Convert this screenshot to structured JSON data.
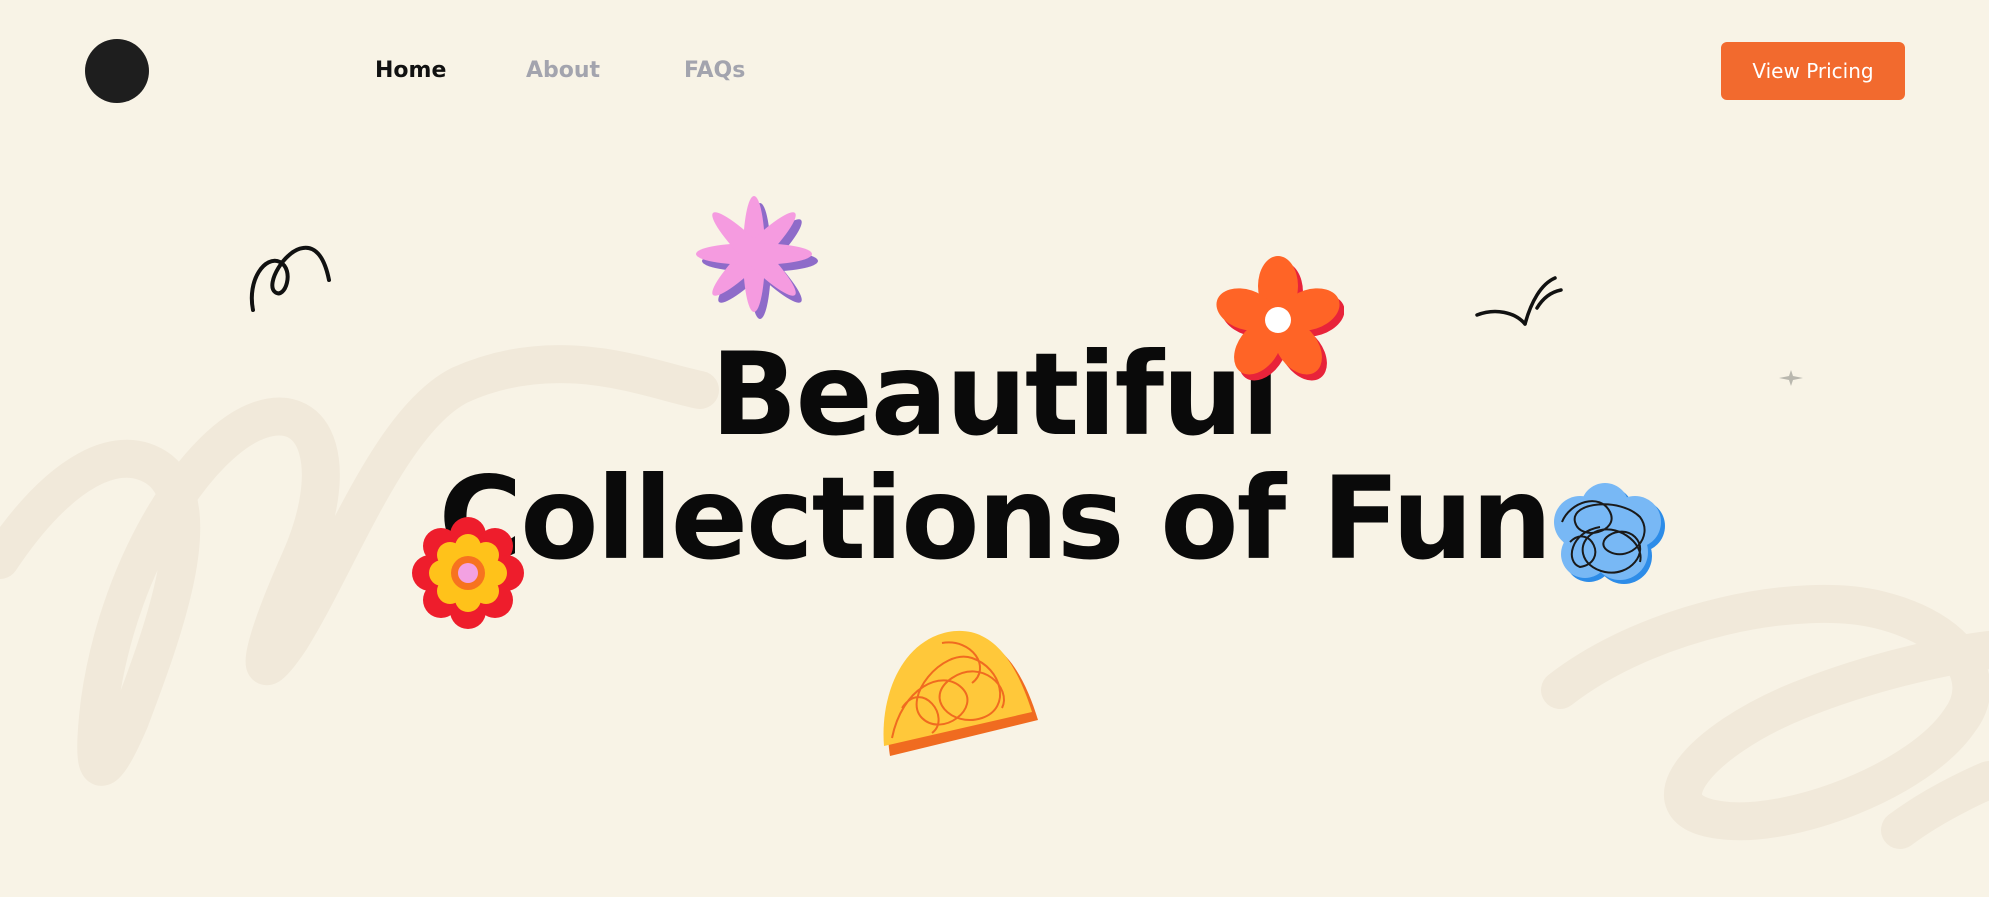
{
  "nav": {
    "items": [
      {
        "label": "Home",
        "state": "active"
      },
      {
        "label": "About",
        "state": "inactive"
      },
      {
        "label": "FAQs",
        "state": "inactive"
      }
    ],
    "cta_label": "View Pricing"
  },
  "hero": {
    "line1": "Beautiful",
    "line2": "Collections of Fun"
  },
  "colors": {
    "background": "#F8F3E6",
    "accent": "#F26A2E",
    "text": "#0A0A0A",
    "nav_muted": "#A3A4AE"
  },
  "icons": [
    "logo-circle",
    "squiggle-loop-icon",
    "pink-star-flower-icon",
    "orange-daisy-icon",
    "check-sprout-icon",
    "sparkle-icon",
    "red-yellow-flower-icon",
    "blue-scribble-blob-icon",
    "yellow-scribble-dome-icon"
  ]
}
